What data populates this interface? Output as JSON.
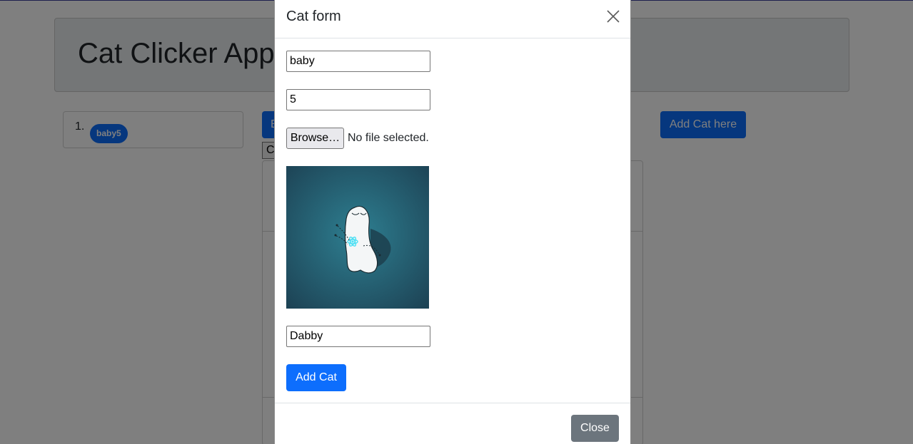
{
  "page": {
    "heading": "Cat Clicker App"
  },
  "cat_list": {
    "items": [
      {
        "number": "1.",
        "label": "baby5"
      }
    ]
  },
  "background_buttons": {
    "edit_label": "E",
    "click_label": "C",
    "add_cat_here_label": "Add Cat here"
  },
  "modal": {
    "title": "Cat form",
    "name_value": "baby",
    "clicks_value": "5",
    "browse_label": "Browse…",
    "file_status": "No file selected.",
    "nickname_value": "Dabby",
    "add_cat_label": "Add Cat",
    "close_label": "Close"
  },
  "icons": {
    "close": "close-icon",
    "preview": "ghost-atom-illustration"
  },
  "colors": {
    "primary": "#0d6efd",
    "secondary": "#6c757d",
    "preview_bg_center": "#2e7f91",
    "preview_bg_edge": "#1d4355"
  }
}
